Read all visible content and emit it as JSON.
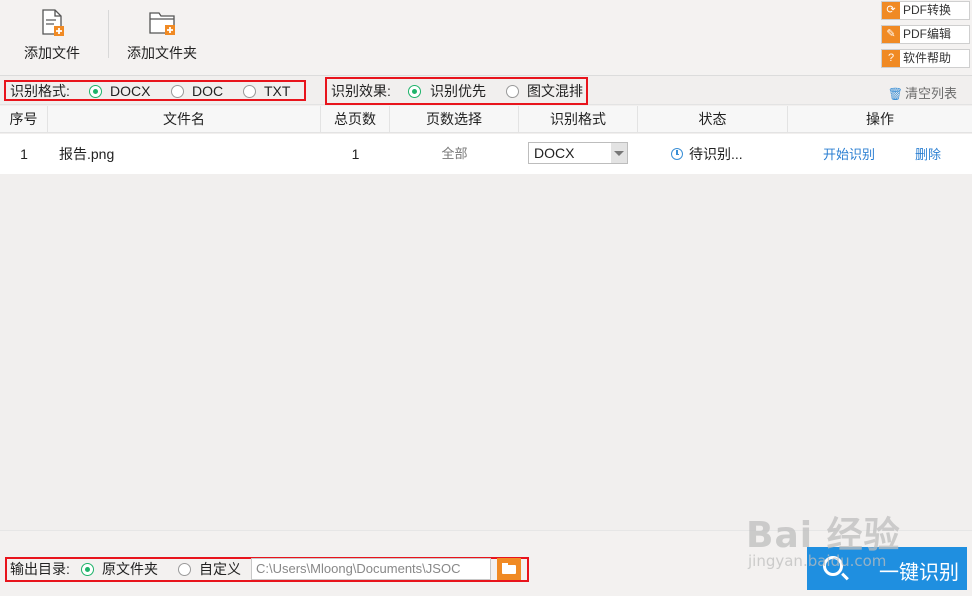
{
  "toolbar": {
    "add_file": "添加文件",
    "add_folder": "添加文件夹"
  },
  "side_buttons": {
    "pdf_convert": "PDF转换",
    "pdf_edit": "PDF编辑",
    "help": "软件帮助",
    "help_glyph": "?"
  },
  "options": {
    "format_label": "识别格式:",
    "format_options": [
      "DOCX",
      "DOC",
      "TXT"
    ],
    "format_selected": "DOCX",
    "effect_label": "识别效果:",
    "effect_options": [
      "识别优先",
      "图文混排"
    ],
    "effect_selected": "识别优先",
    "clear_list": "清空列表"
  },
  "table": {
    "columns": [
      "序号",
      "文件名",
      "总页数",
      "页数选择",
      "识别格式",
      "状态",
      "操作"
    ],
    "rows": [
      {
        "index": "1",
        "filename": "报告.png",
        "pages": "1",
        "page_range": "全部",
        "format": "DOCX",
        "status": "待识别...",
        "action_start": "开始识别",
        "action_delete": "删除"
      }
    ]
  },
  "bottom": {
    "output_label": "输出目录:",
    "output_options": [
      "原文件夹",
      "自定义"
    ],
    "output_selected": "原文件夹",
    "path": "C:\\Users\\Mloong\\Documents\\JSOC",
    "recognize_button": "一键识别"
  },
  "watermark": {
    "brand": "Bai 经验",
    "url": "jingyan.baidu.com"
  },
  "colors": {
    "accent": "#1f8fe0",
    "orange": "#f08a24",
    "radio_on": "#1eb36a",
    "highlight_box": "#e8141c"
  }
}
